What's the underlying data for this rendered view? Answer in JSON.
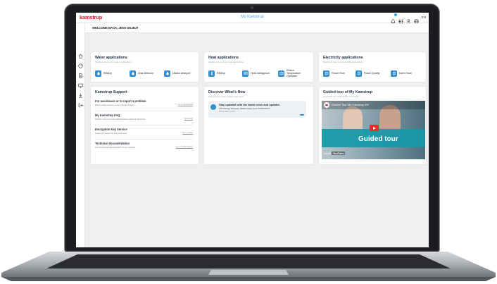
{
  "app": {
    "logo": "kamstrup",
    "title": "My Kamstrup",
    "lang": "EN",
    "welcome": "WELCOME BACK, JENS DEJBJT"
  },
  "sidebar": [
    "home-icon",
    "dashboard-icon",
    "document-icon",
    "monitor-icon",
    "download-icon",
    "logout-icon"
  ],
  "water": {
    "title": "Water applications",
    "subtitle": "Quickly access your water applications",
    "items": [
      "READy",
      "Leak Detector",
      "District Analyzer"
    ]
  },
  "heat": {
    "title": "Heat applications",
    "subtitle": "Quickly access your heat applications",
    "items": [
      "READy",
      "Heat Intelligence",
      "Return Temperature Optimizer"
    ]
  },
  "electricity": {
    "title": "Electricity applications",
    "subtitle": "Quickly access your electricity applications",
    "items": [
      "Power Flow",
      "Power Quality",
      "Earth Fault"
    ]
  },
  "support": {
    "title": "Kamstrup Support",
    "rows": [
      {
        "title": "For assistance or to report a problem",
        "desc": "Please create a ticket to ensure the best support",
        "link": "Go to Servicedesk"
      },
      {
        "title": "My Kamstrup FAQ",
        "desc": "Find the most commonly asked questions about My Kamstrup",
        "link": "Go to FAQ"
      },
      {
        "title": "Encryption Key Service",
        "desc": "Guides and support for encryption keys",
        "link": "Go to guides"
      },
      {
        "title": "Technical documentation",
        "desc": "Find all technical documentation for your products",
        "link": "Go to Product guides"
      }
    ]
  },
  "news": {
    "title": "Discover What's New",
    "subtitle": "Stay informed with updates and news",
    "item_title": "Stay updated with the latest news and updates",
    "item_text": "Introducing \"Discover What's New\" and \"Notifications\"",
    "item_date": "19 nov, 2024 | 13:46"
  },
  "tour": {
    "title": "Guided tour of My Kamstrup",
    "subtitle": "Find what you need quickly and easily",
    "video_title": "Guided Tour My Kamstrup EN",
    "video_big": "Guided tour",
    "watch_on": "Se på",
    "yt": "YouTube"
  },
  "colors": {
    "brand": "#d6202f",
    "accent": "#2f8fd0",
    "title_blue": "#3aa4d9"
  }
}
